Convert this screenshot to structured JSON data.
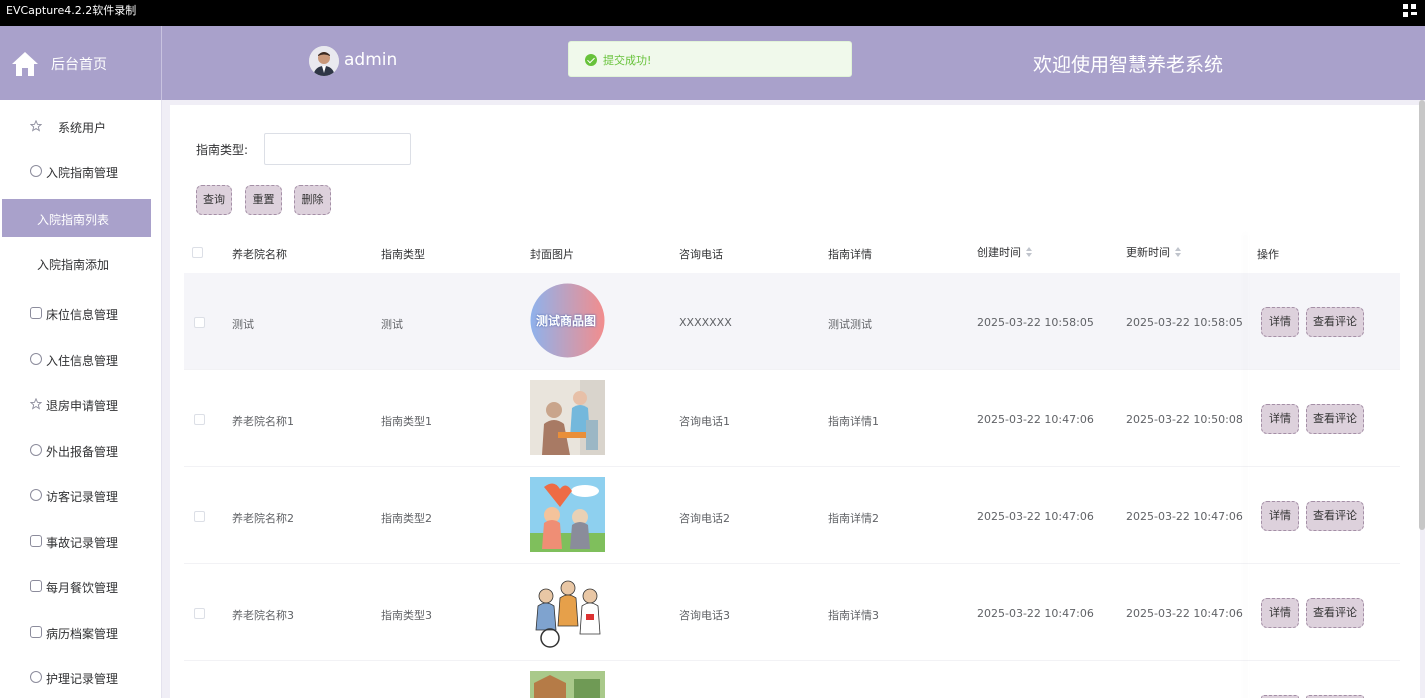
{
  "recorder": {
    "title": "EVCapture4.2.2软件录制"
  },
  "header": {
    "brand_label": "后台首页",
    "username": "admin",
    "toast_message": "提交成功!",
    "welcome": "欢迎使用智慧养老系统"
  },
  "sidebar": {
    "items": [
      {
        "label": "系统用户",
        "icon": "star-icon"
      },
      {
        "label": "入院指南管理",
        "icon": "clock-icon"
      },
      {
        "label": "入院指南列表",
        "active": true
      },
      {
        "label": "入院指南添加"
      },
      {
        "label": "床位信息管理",
        "icon": "calendar-icon"
      },
      {
        "label": "入住信息管理",
        "icon": "clock-icon"
      },
      {
        "label": "退房申请管理",
        "icon": "star-icon"
      },
      {
        "label": "外出报备管理",
        "icon": "compass-icon"
      },
      {
        "label": "访客记录管理",
        "icon": "clock-icon"
      },
      {
        "label": "事故记录管理",
        "icon": "calendar-check-icon"
      },
      {
        "label": "每月餐饮管理",
        "icon": "calendar-icon"
      },
      {
        "label": "病历档案管理",
        "icon": "calendar-check-icon"
      },
      {
        "label": "护理记录管理",
        "icon": "clock-icon"
      }
    ]
  },
  "filter": {
    "label": "指南类型:",
    "value": ""
  },
  "buttons": {
    "query": "查询",
    "reset": "重置",
    "delete": "删除"
  },
  "table": {
    "headers": {
      "name": "养老院名称",
      "type": "指南类型",
      "cover": "封面图片",
      "phone": "咨询电话",
      "detail": "指南详情",
      "created": "创建时间",
      "updated": "更新时间",
      "ops": "操作"
    },
    "row_buttons": {
      "detail": "详情",
      "comments": "查看评论"
    },
    "rows": [
      {
        "name": "测试",
        "type": "测试",
        "cover_text": "测试商品图",
        "phone": "XXXXXXX",
        "detail": "测试测试",
        "created": "2025-03-22 10:58:05",
        "updated": "2025-03-22 10:58:05"
      },
      {
        "name": "养老院名称1",
        "type": "指南类型1",
        "phone": "咨询电话1",
        "detail": "指南详情1",
        "created": "2025-03-22 10:47:06",
        "updated": "2025-03-22 10:50:08"
      },
      {
        "name": "养老院名称2",
        "type": "指南类型2",
        "phone": "咨询电话2",
        "detail": "指南详情2",
        "created": "2025-03-22 10:47:06",
        "updated": "2025-03-22 10:47:06"
      },
      {
        "name": "养老院名称3",
        "type": "指南类型3",
        "phone": "咨询电话3",
        "detail": "指南详情3",
        "created": "2025-03-22 10:47:06",
        "updated": "2025-03-22 10:47:06"
      }
    ]
  },
  "colors": {
    "primary": "#a9a1cb",
    "button_bg": "#ddd1dc",
    "success": "#67c23a"
  }
}
